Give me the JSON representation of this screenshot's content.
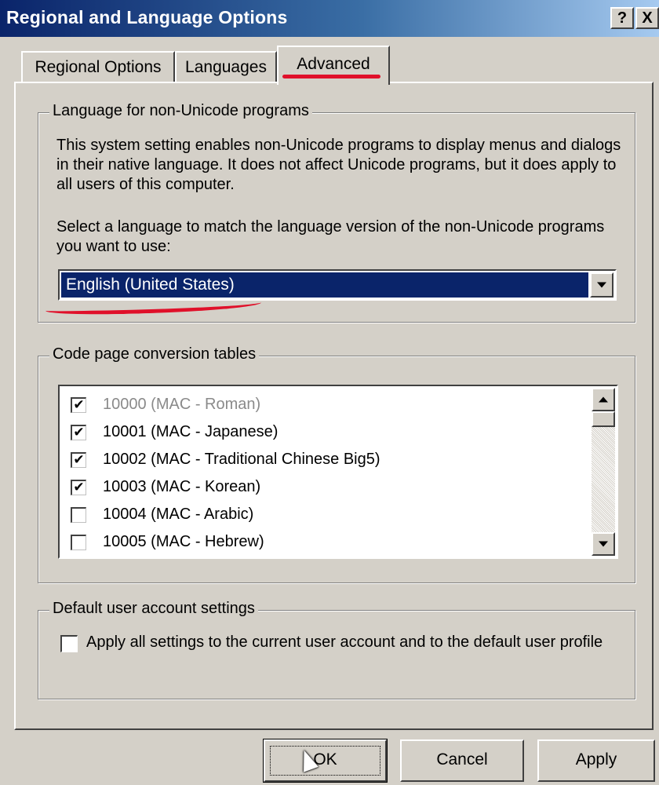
{
  "window": {
    "title": "Regional and Language Options",
    "help_glyph": "?",
    "close_glyph": "X"
  },
  "tabs": [
    {
      "label": "Regional Options",
      "active": false
    },
    {
      "label": "Languages",
      "active": false
    },
    {
      "label": "Advanced",
      "active": true
    }
  ],
  "language_group": {
    "legend": "Language for non-Unicode programs",
    "description": "This system setting enables non-Unicode programs to display menus and dialogs in their native language. It does not affect Unicode programs, but it does apply to all users of this computer.",
    "prompt": "Select a language to match the language version of the non-Unicode programs you want to use:",
    "selected_language": "English (United States)"
  },
  "code_page_group": {
    "legend": "Code page conversion tables",
    "items": [
      {
        "label": "10000 (MAC - Roman)",
        "checked": true,
        "disabled": true
      },
      {
        "label": "10001 (MAC - Japanese)",
        "checked": true,
        "disabled": false
      },
      {
        "label": "10002 (MAC - Traditional Chinese Big5)",
        "checked": true,
        "disabled": false
      },
      {
        "label": "10003 (MAC - Korean)",
        "checked": true,
        "disabled": false
      },
      {
        "label": "10004 (MAC - Arabic)",
        "checked": false,
        "disabled": false
      },
      {
        "label": "10005 (MAC - Hebrew)",
        "checked": false,
        "disabled": false
      }
    ]
  },
  "user_group": {
    "legend": "Default user account settings",
    "checkbox_label": "Apply all settings to the current user account and to the default user profile",
    "checked": false
  },
  "buttons": {
    "ok": "OK",
    "cancel": "Cancel",
    "apply": "Apply"
  },
  "colors": {
    "annotation_mark": "#e0102a",
    "selection": "#0a246a",
    "dialog_face": "#d4d0c8"
  }
}
